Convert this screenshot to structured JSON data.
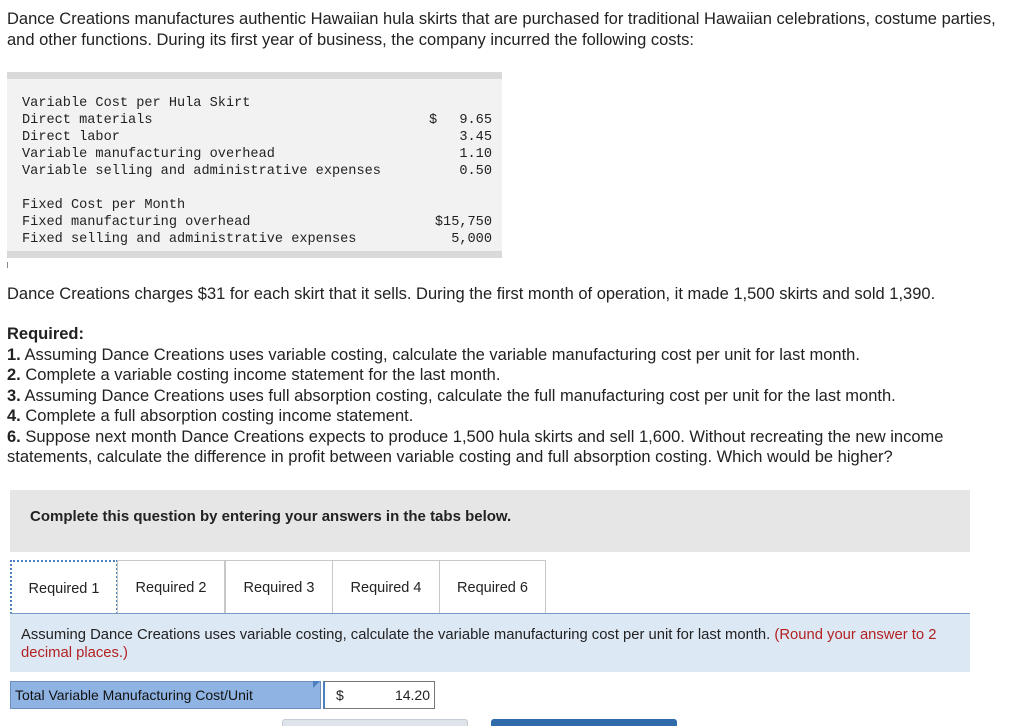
{
  "intro": "Dance Creations manufactures authentic Hawaiian hula skirts that are purchased for traditional Hawaiian celebrations, costume parties, and other functions. During its first year of business, the company incurred the following costs:",
  "cost_table": {
    "variable_heading": "Variable Cost per Hula Skirt",
    "variable_rows": [
      {
        "label": "Direct materials",
        "currency": "$",
        "amount": "9.65"
      },
      {
        "label": "Direct labor",
        "amount": "3.45"
      },
      {
        "label": "Variable manufacturing overhead",
        "amount": "1.10"
      },
      {
        "label": "Variable selling and administrative expenses",
        "amount": "0.50"
      }
    ],
    "fixed_heading": "Fixed Cost per Month",
    "fixed_rows": [
      {
        "label": "Fixed manufacturing overhead",
        "amount": "$15,750"
      },
      {
        "label": "Fixed selling and administrative expenses",
        "amount": "5,000"
      }
    ]
  },
  "charges_text": "Dance Creations charges $31 for each skirt that it sells. During the first month of operation, it made 1,500 skirts and sold 1,390.",
  "required": {
    "heading": "Required:",
    "items": [
      {
        "num": "1.",
        "text": " Assuming Dance Creations uses variable costing, calculate the variable manufacturing cost per unit for last month."
      },
      {
        "num": "2.",
        "text": " Complete a variable costing income statement for the last month."
      },
      {
        "num": "3.",
        "text": " Assuming Dance Creations uses full absorption costing, calculate the full manufacturing cost per unit for the last month."
      },
      {
        "num": "4.",
        "text": " Complete a full absorption costing income statement."
      },
      {
        "num": "6.",
        "text": " Suppose next month Dance Creations expects to produce 1,500 hula skirts and sell 1,600. Without recreating the new income statements, calculate the difference in profit between variable costing and full absorption costing. Which would be higher?"
      }
    ]
  },
  "instruction": "Complete this question by entering your answers in the tabs below.",
  "tabs": [
    {
      "label": "Required 1",
      "active": true
    },
    {
      "label": "Required 2"
    },
    {
      "label": "Required 3"
    },
    {
      "label": "Required 4"
    },
    {
      "label": "Required 6"
    }
  ],
  "panel": {
    "question": "Assuming Dance Creations uses variable costing, calculate the variable manufacturing cost per unit for last month.",
    "hint": "(Round your answer to 2 decimal places.)"
  },
  "answer": {
    "label": "Total Variable Manufacturing Cost/Unit",
    "currency": "$",
    "value": "14.20"
  },
  "colors": {
    "tab_active_border": "#4a7fc0",
    "answer_label_bg": "#8fb4e3",
    "hint": "#b22222",
    "panel_bg": "#dde8f5",
    "next_button": "#2f6aab"
  }
}
